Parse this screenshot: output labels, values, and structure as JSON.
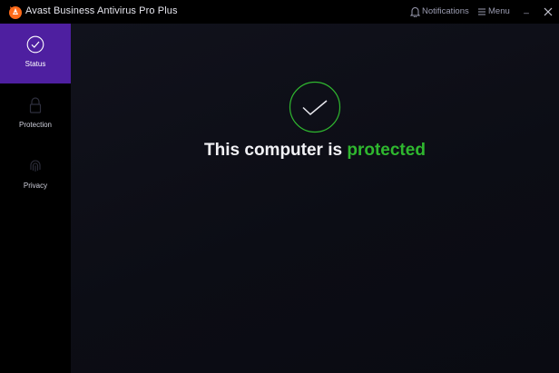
{
  "window": {
    "title": "Avast Business Antivirus Pro Plus",
    "logo_icon": "avast-logo-icon",
    "notifications_label": "Notifications",
    "notifications_icon": "bell-icon",
    "menu_label": "Menu",
    "menu_icon": "hamburger-icon",
    "minimize_label": "_",
    "close_icon": "close-icon"
  },
  "sidebar": {
    "items": [
      {
        "label": "Status",
        "icon": "check-circle-icon",
        "active": true
      },
      {
        "label": "Protection",
        "icon": "lock-icon",
        "active": false
      },
      {
        "label": "Privacy",
        "icon": "fingerprint-icon",
        "active": false
      }
    ]
  },
  "main": {
    "status_icon": "checkmark-ring-icon",
    "headline_prefix": "This computer is",
    "headline_status": "protected"
  },
  "colors": {
    "accent_purple": "#4e1fa0",
    "status_green": "#2fb72f",
    "logo_orange": "#ff6b1a"
  }
}
